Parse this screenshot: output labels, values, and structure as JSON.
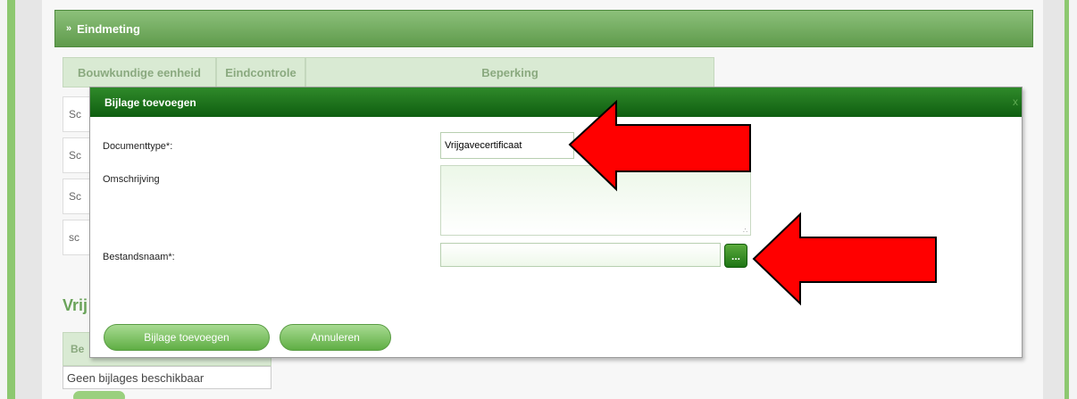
{
  "section": {
    "title": "Eindmeting",
    "chevron_glyph": "»"
  },
  "background_table": {
    "headers": [
      "Bouwkundige eenheid",
      "Eindcontrole",
      "Beperking"
    ],
    "row_stubs": [
      "Sc",
      "Sc",
      "Sc",
      "sc"
    ]
  },
  "background_vrij": {
    "label": "Vrij",
    "table_header_stub": "Be",
    "empty_text": "Geen bijlages beschikbaar"
  },
  "dialog": {
    "title": "Bijlage toevoegen",
    "close_glyph": "x",
    "fields": {
      "documenttype_label": "Documenttype*:",
      "documenttype_value": "Vrijgavecertificaat",
      "omschrijving_label": "Omschrijving",
      "omschrijving_value": "",
      "bestandsnaam_label": "Bestandsnaam*:",
      "bestandsnaam_value": "",
      "browse_label": "..."
    },
    "buttons": {
      "add": "Bijlage toevoegen",
      "cancel": "Annuleren"
    }
  },
  "colors": {
    "header_green": "#5f9b4c",
    "dialog_title_green": "#0f5e10",
    "button_green": "#5fae44",
    "annotation_arrow": "#ff0000"
  },
  "annotations": [
    {
      "name": "red-arrow-documenttype",
      "points_to": "documenttype-input"
    },
    {
      "name": "red-arrow-browse",
      "points_to": "browse-button"
    }
  ]
}
